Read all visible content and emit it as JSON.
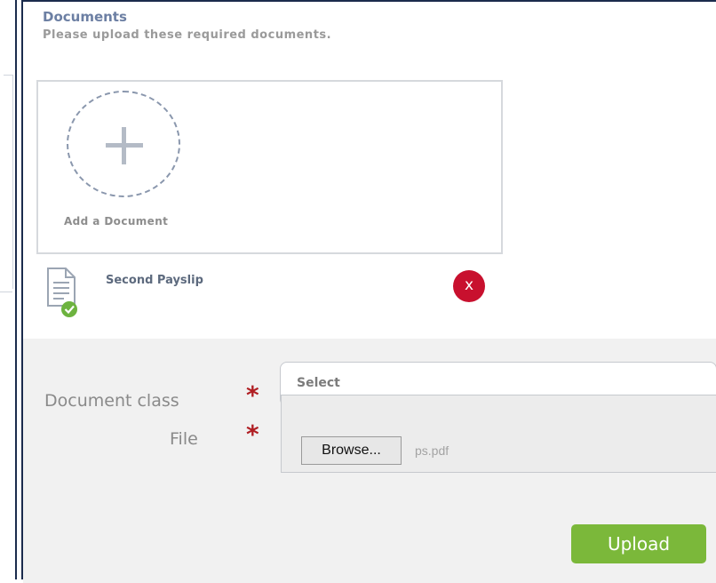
{
  "documents": {
    "title": "Documents",
    "subtitle": "Please upload these required documents.",
    "add_label": "Add a Document",
    "uploaded": [
      {
        "name": "Second Payslip",
        "icon": "document-check-icon",
        "remove_label": "x"
      }
    ]
  },
  "form": {
    "document_class": {
      "label": "Document class",
      "required_mark": "*",
      "value": "Select"
    },
    "file": {
      "label": "File",
      "required_mark": "*",
      "browse_label": "Browse...",
      "value": "ps.pdf"
    },
    "upload_label": "Upload"
  },
  "colors": {
    "title": "#6c7fa3",
    "remove": "#c8102e",
    "required": "#b01e23",
    "upload": "#7bb83a",
    "border": "#1b2b4d"
  }
}
